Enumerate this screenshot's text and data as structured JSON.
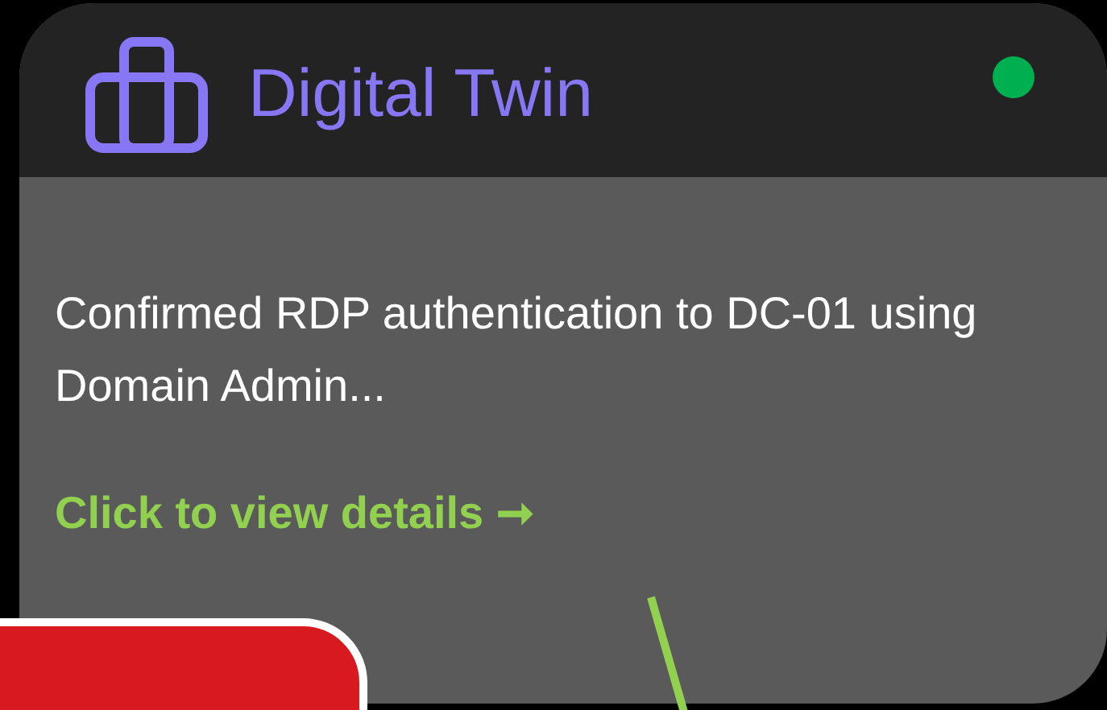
{
  "card": {
    "title": "Digital Twin",
    "status_dot": {
      "color": "#00b050"
    },
    "description": "Confirmed RDP authentication to DC-01 using Domain Admin...",
    "link": "Click to view details ➞"
  }
}
